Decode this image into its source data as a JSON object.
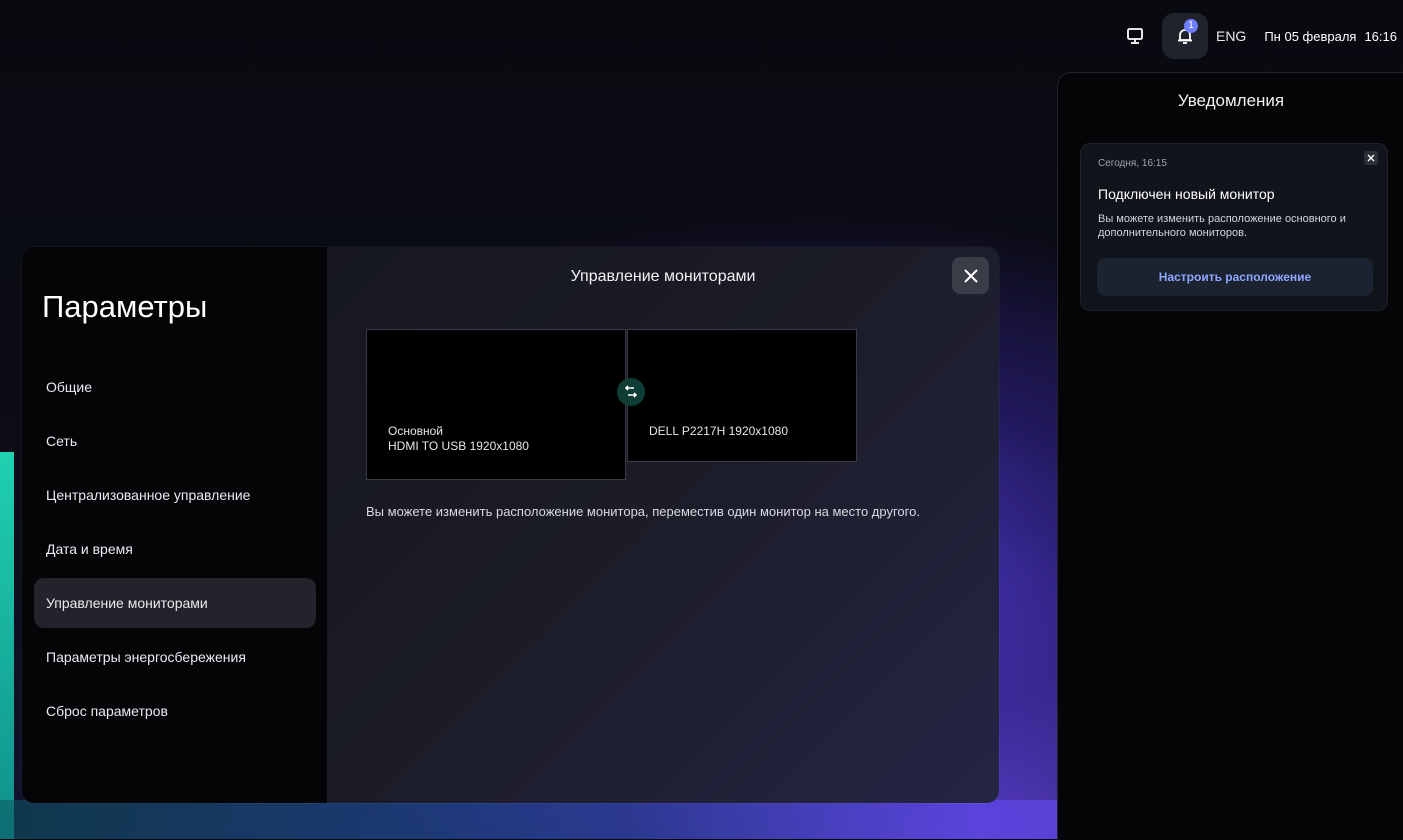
{
  "topbar": {
    "display_icon": "monitor-icon",
    "bell_icon": "bell-icon",
    "notification_count": "1",
    "language": "ENG",
    "date": "Пн 05 февраля",
    "time": "16:16"
  },
  "notifications": {
    "title": "Уведомления",
    "items": [
      {
        "time": "Сегодня, 16:15",
        "title": "Подключен новый монитор",
        "body": "Вы можете изменить расположение основного и дополнительного мониторов.",
        "action_label": "Настроить расположение"
      }
    ]
  },
  "settings": {
    "title": "Параметры",
    "nav": [
      {
        "label": "Общие"
      },
      {
        "label": "Сеть"
      },
      {
        "label": "Централизованное управление"
      },
      {
        "label": "Дата и время"
      },
      {
        "label": "Управление мониторами"
      },
      {
        "label": "Параметры энергосбережения"
      },
      {
        "label": "Сброс параметров"
      }
    ],
    "active_index": 4
  },
  "monitors_page": {
    "title": "Управление мониторами",
    "primary": {
      "role": "Основной",
      "name": "HDMI TO USB 1920x1080"
    },
    "secondary": {
      "name": "DELL P2217H 1920x1080"
    },
    "hint": "Вы можете изменить расположение монитора, переместив один монитор на место другого."
  },
  "colors": {
    "accent": "#8ea6ff",
    "badge": "#6f7dff",
    "swap": "#0e3d36"
  }
}
